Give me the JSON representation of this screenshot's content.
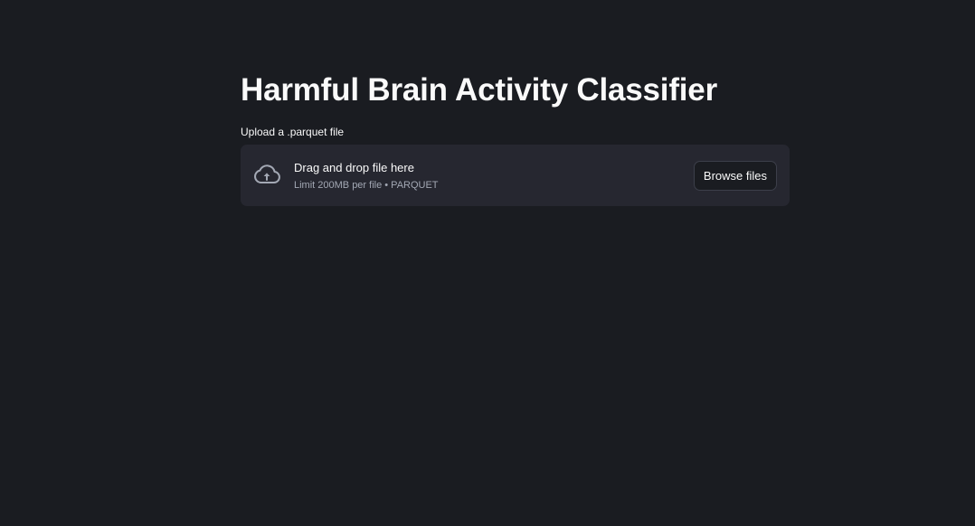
{
  "page": {
    "title": "Harmful Brain Activity Classifier"
  },
  "uploader": {
    "label": "Upload a .parquet file",
    "icon": "cloud-upload-icon",
    "drop_title": "Drag and drop file here",
    "drop_limit": "Limit 200MB per file • PARQUET",
    "browse_label": "Browse files"
  },
  "colors": {
    "background": "#1a1c21",
    "dropzone": "#262730",
    "text": "#fafafa",
    "muted_text": "#a3a8b4"
  }
}
